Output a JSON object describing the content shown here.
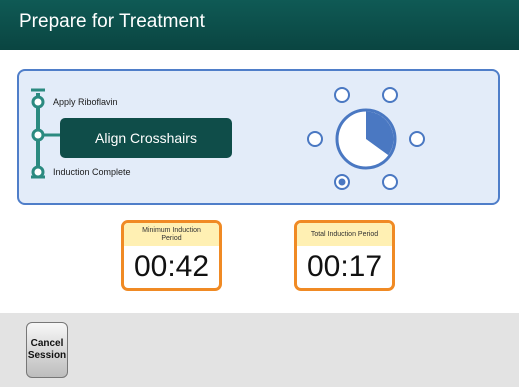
{
  "header": {
    "title": "Prepare for Treatment"
  },
  "steps": [
    {
      "label": "Apply Riboflavin",
      "state": "done"
    },
    {
      "label": "Align Crosshairs",
      "state": "current"
    },
    {
      "label": "Induction Complete",
      "state": "pending"
    }
  ],
  "position_selector": {
    "positions": 6,
    "selected_position": "bottom-center",
    "pie_fill_fraction": 0.35
  },
  "timers": {
    "minimum_induction": {
      "label": "Minimum Induction Period",
      "value": "00:42"
    },
    "total_induction": {
      "label": "Total Induction Period",
      "value": "00:17"
    }
  },
  "footer": {
    "cancel_label": "Cancel\nSession"
  },
  "colors": {
    "header_bg": "#0f5a55",
    "panel_bg": "#e3ecf9",
    "panel_border": "#4f7ec9",
    "step_track": "#2b8a80",
    "current_step_bg": "#0f4d49",
    "timer_border": "#f08a24",
    "timer_header_bg": "#fff0b3",
    "pie_fill": "#4a78c2"
  }
}
